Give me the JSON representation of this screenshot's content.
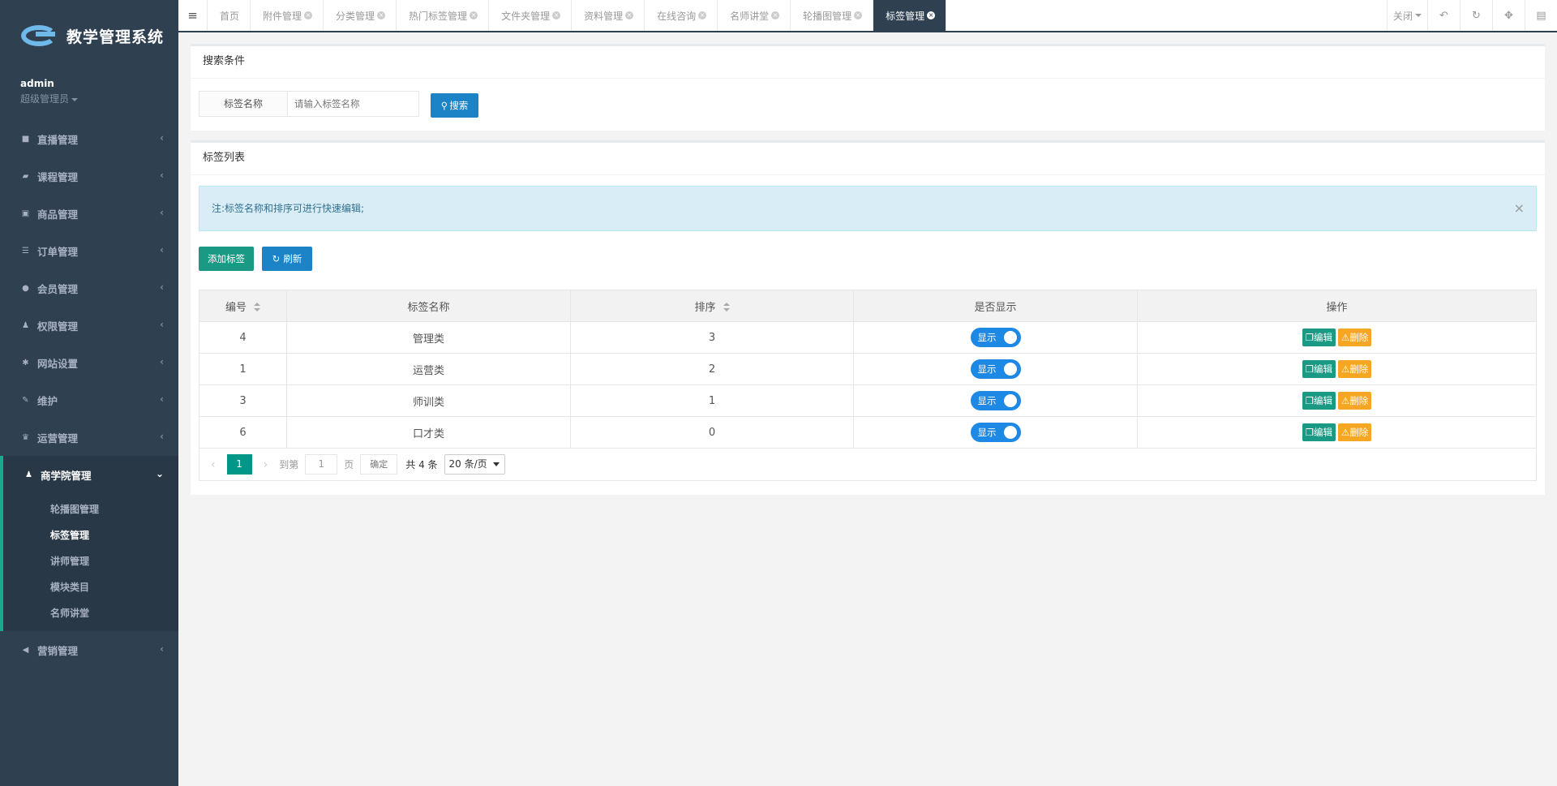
{
  "app": {
    "name": "教学管理系统"
  },
  "profile": {
    "username": "admin",
    "role": "超级管理员"
  },
  "sidebar": {
    "items": [
      {
        "label": "直播管理",
        "icon": "video-icon"
      },
      {
        "label": "课程管理",
        "icon": "book-icon"
      },
      {
        "label": "商品管理",
        "icon": "cart-icon"
      },
      {
        "label": "订单管理",
        "icon": "list-icon"
      },
      {
        "label": "会员管理",
        "icon": "user-icon"
      },
      {
        "label": "权限管理",
        "icon": "users-icon"
      },
      {
        "label": "网站设置",
        "icon": "gear-icon"
      },
      {
        "label": "维护",
        "icon": "wrench-icon"
      },
      {
        "label": "运营管理",
        "icon": "trophy-icon"
      }
    ],
    "active": {
      "label": "商学院管理",
      "icon": "users-icon"
    },
    "submenu": [
      "轮播图管理",
      "标签管理",
      "讲师管理",
      "模块类目",
      "名师讲堂"
    ],
    "submenu_current": "标签管理",
    "last": {
      "label": "营销管理",
      "icon": "bullhorn-icon"
    }
  },
  "tabs": [
    "首页",
    "附件管理",
    "分类管理",
    "热门标签管理",
    "文件夹管理",
    "资料管理",
    "在线咨询",
    "名师讲堂",
    "轮播图管理",
    "标签管理"
  ],
  "active_tab": "标签管理",
  "topbar": {
    "close_label": "关闭"
  },
  "search": {
    "title": "搜索条件",
    "label": "标签名称",
    "placeholder": "请输入标签名称",
    "button": "搜索"
  },
  "list": {
    "title": "标签列表",
    "notice": "注:标签名称和排序可进行快速编辑;",
    "add_button": "添加标签",
    "refresh_button": "刷新",
    "columns": [
      "编号",
      "标签名称",
      "排序",
      "是否显示",
      "操作"
    ],
    "rows": [
      {
        "id": "4",
        "name": "管理类",
        "sort": "3",
        "show": "显示"
      },
      {
        "id": "1",
        "name": "运营类",
        "sort": "2",
        "show": "显示"
      },
      {
        "id": "3",
        "name": "师训类",
        "sort": "1",
        "show": "显示"
      },
      {
        "id": "6",
        "name": "口才类",
        "sort": "0",
        "show": "显示"
      }
    ],
    "edit_label": "编辑",
    "delete_label": "删除"
  },
  "pagination": {
    "current": "1",
    "goto_label": "到第",
    "goto_value": "1",
    "page_suffix": "页",
    "confirm": "确定",
    "total": "共 4 条",
    "page_size": "20 条/页"
  },
  "colors": {
    "sidebar": "#2f4050",
    "accent": "#19aa8d",
    "primary": "#1c84c6",
    "warning": "#f5a623"
  }
}
